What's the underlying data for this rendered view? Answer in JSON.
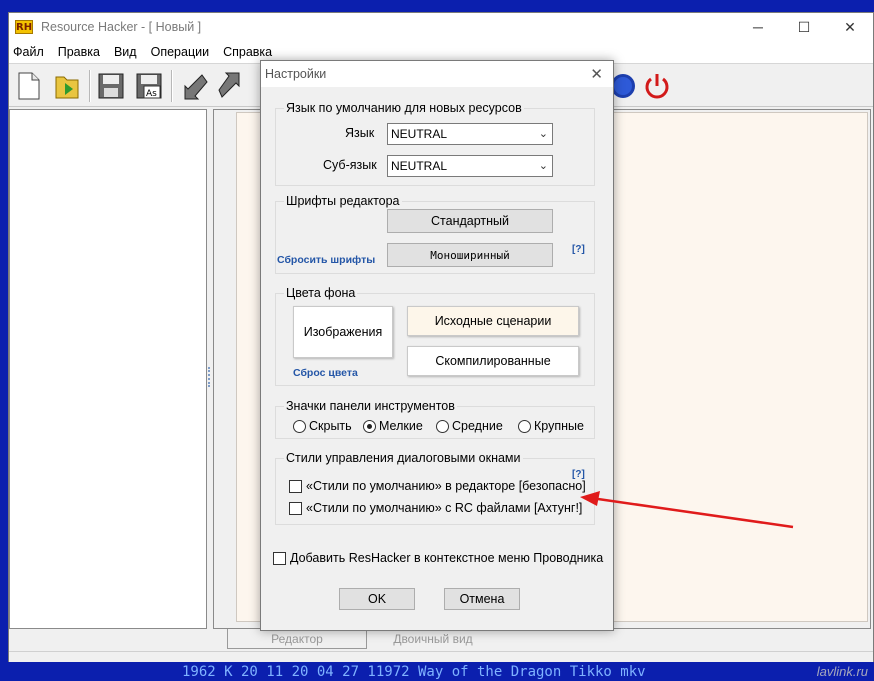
{
  "app": {
    "title": "Resource Hacker - [ Новый ]",
    "logo_text": "RH",
    "window_controls": {
      "minimize": "─",
      "maximize": "☐",
      "close": "✕"
    }
  },
  "menu": [
    "Файл",
    "Правка",
    "Вид",
    "Операции",
    "Справка"
  ],
  "tabs": {
    "editor": "Редактор",
    "binary": "Двоичный вид"
  },
  "background": {
    "console_line": "1962 К 20 11 20 04 27 11972 Way of the Dragon Tikko mkv",
    "watermark": "lavlink.ru"
  },
  "dialog": {
    "title": "Настройки",
    "close": "✕",
    "lang_group": {
      "legend": "Язык по умолчанию для новых ресурсов",
      "language_label": "Язык",
      "language_value": "NEUTRAL",
      "sublanguage_label": "Суб-язык",
      "sublanguage_value": "NEUTRAL"
    },
    "fonts_group": {
      "legend": "Шрифты редактора",
      "standard_button": "Стандартный",
      "mono_button": "Моноширинный",
      "reset_link": "Сбросить шрифты",
      "help": "[?]"
    },
    "bg_group": {
      "legend": "Цвета фона",
      "images_button": "Изображения",
      "source_button": "Исходные сценарии",
      "compiled_button": "Скомпилированные",
      "reset_link": "Сброс цвета"
    },
    "icons_group": {
      "legend": "Значки панели инструментов",
      "options": [
        "Скрыть",
        "Мелкие",
        "Средние",
        "Крупные"
      ],
      "selected": "Мелкие"
    },
    "styles_group": {
      "legend": "Стили управления диалоговыми окнами",
      "help": "[?]",
      "check_editor": "«Стили по умолчанию» в редакторе [безопасно]",
      "check_rc": "«Стили по умолчанию» с RC файлами [Ахтунг!]"
    },
    "context_menu_check": "Добавить ResHacker в контекстное меню Проводника",
    "ok": "OK",
    "cancel": "Отмена"
  },
  "colors": {
    "arrow": "#e01b1b",
    "link": "#2456a7",
    "desktop": "#0b1fae",
    "editor_bg": "#fdf6ee"
  }
}
